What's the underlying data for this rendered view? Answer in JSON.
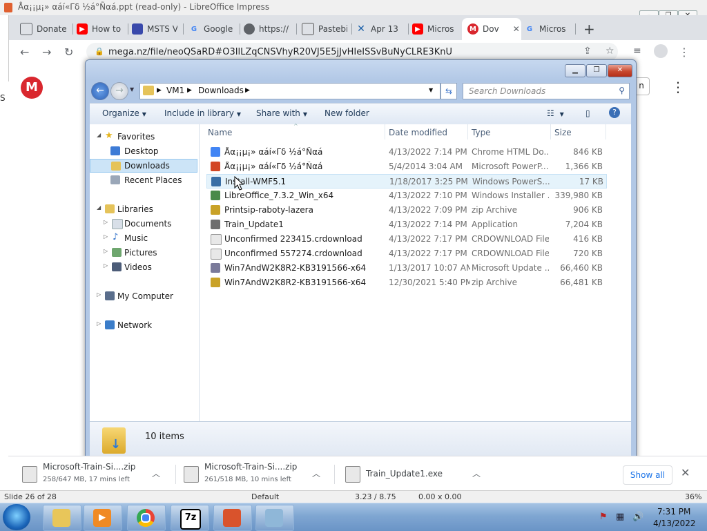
{
  "lo_window": {
    "title": "Åα¡¡µ¡» αáí«Γδ ½á°Ñαá.ppt (read-only) - LibreOffice Impress",
    "status_slide": "Slide 26 of 28",
    "status_layout": "Default",
    "status_pos": "3.23 / 8.75",
    "status_size": "0.00 x 0.00",
    "status_zoom": "36%"
  },
  "chrome": {
    "tabs": [
      {
        "label": "Donate",
        "icon": "page-icon",
        "color": "#5f6368"
      },
      {
        "label": "How to",
        "icon": "youtube-icon",
        "color": "#ff0000"
      },
      {
        "label": "MSTS V",
        "icon": "msts-icon",
        "color": "#3949ab"
      },
      {
        "label": "Google",
        "icon": "google-icon",
        "color": "#4285f4"
      },
      {
        "label": "https://",
        "icon": "globe-icon",
        "color": "#5f6368"
      },
      {
        "label": "Pastebi",
        "icon": "pastebin-icon",
        "color": "#555555"
      },
      {
        "label": "Apr 13",
        "icon": "cross-icon",
        "color": "#1a5fa8"
      },
      {
        "label": "Micros",
        "icon": "youtube-icon",
        "color": "#ff0000"
      },
      {
        "label": "Dov",
        "icon": "mega-icon",
        "color": "#d9272e"
      },
      {
        "label": "Micros",
        "icon": "google-icon",
        "color": "#4285f4"
      }
    ],
    "new_tab": "+",
    "url": "mega.nz/file/neoQSaRD#O3IlLZqCNSVhyR20VJ5E5jJvHIeISSvBuNyCLRE3KnU"
  },
  "mega": {
    "logo": "M",
    "side_text": "S",
    "menu": "⋮",
    "btn_partial": "n"
  },
  "explorer": {
    "breadcrumb": [
      "VM1",
      "Downloads"
    ],
    "search_placeholder": "Search Downloads",
    "toolbar": {
      "organize": "Organize",
      "include": "Include in library",
      "share": "Share with",
      "new_folder": "New folder"
    },
    "nav": {
      "favorites": "Favorites",
      "desktop": "Desktop",
      "downloads": "Downloads",
      "recent": "Recent Places",
      "libraries": "Libraries",
      "documents": "Documents",
      "music": "Music",
      "pictures": "Pictures",
      "videos": "Videos",
      "computer": "My Computer",
      "network": "Network"
    },
    "columns": {
      "name": "Name",
      "date": "Date modified",
      "type": "Type",
      "size": "Size"
    },
    "files": [
      {
        "name": "Åα¡¡µ¡» αáí«Γδ ½á°Ñαá",
        "date": "4/13/2022 7:14 PM",
        "type": "Chrome HTML Do...",
        "size": "846 KB",
        "icon": "chrome-html-icon",
        "color": "#4285f4"
      },
      {
        "name": "Åα¡¡µ¡» αáí«Γδ ½á°Ñαá",
        "date": "5/4/2014 3:04 AM",
        "type": "Microsoft PowerP...",
        "size": "1,366 KB",
        "icon": "powerpoint-icon",
        "color": "#d24726"
      },
      {
        "name": "Install-WMF5.1",
        "date": "1/18/2017 3:25 PM",
        "type": "Windows PowerS...",
        "size": "17 KB",
        "icon": "powershell-icon",
        "color": "#3a6ea5"
      },
      {
        "name": "LibreOffice_7.3.2_Win_x64",
        "date": "4/13/2022 7:10 PM",
        "type": "Windows Installer ...",
        "size": "339,980 KB",
        "icon": "msi-icon",
        "color": "#4a8a4a"
      },
      {
        "name": "Printsip-raboty-lazera",
        "date": "4/13/2022 7:09 PM",
        "type": "zip Archive",
        "size": "906 KB",
        "icon": "zip-icon",
        "color": "#c9a227"
      },
      {
        "name": "Train_Update1",
        "date": "4/13/2022 7:14 PM",
        "type": "Application",
        "size": "7,204 KB",
        "icon": "exe-icon",
        "color": "#6d6d6d"
      },
      {
        "name": "Unconfirmed 223415.crdownload",
        "date": "4/13/2022 7:17 PM",
        "type": "CRDOWNLOAD File",
        "size": "416 KB",
        "icon": "blank-file-icon",
        "color": "#e8e8e8"
      },
      {
        "name": "Unconfirmed 557274.crdownload",
        "date": "4/13/2022 7:17 PM",
        "type": "CRDOWNLOAD File",
        "size": "720 KB",
        "icon": "blank-file-icon",
        "color": "#e8e8e8"
      },
      {
        "name": "Win7AndW2K8R2-KB3191566-x64",
        "date": "1/13/2017 10:07 AM",
        "type": "Microsoft Update ...",
        "size": "66,460 KB",
        "icon": "msu-icon",
        "color": "#7a7a9a"
      },
      {
        "name": "Win7AndW2K8R2-KB3191566-x64",
        "date": "12/30/2021 5:40 PM",
        "type": "zip Archive",
        "size": "66,481 KB",
        "icon": "zip-icon",
        "color": "#c9a227"
      }
    ],
    "item_count": "10 items"
  },
  "downloads": [
    {
      "file": "Microsoft-Train-Si....zip",
      "status": "258/647 MB, 17 mins left"
    },
    {
      "file": "Microsoft-Train-Si....zip",
      "status": "261/518 MB, 10 mins left"
    },
    {
      "file": "Train_Update1.exe",
      "status": ""
    }
  ],
  "download_bar": {
    "show_all": "Show all"
  },
  "taskbar": {
    "apps": [
      {
        "name": "explorer",
        "glyph": "",
        "bg": "#e8c65a"
      },
      {
        "name": "media-player",
        "glyph": "▶",
        "bg": "#f08a24"
      },
      {
        "name": "chrome",
        "glyph": "",
        "bg": "#4285f4"
      },
      {
        "name": "7zip",
        "glyph": "7z",
        "bg": "#ffffff"
      },
      {
        "name": "libreoffice-impress",
        "glyph": "",
        "bg": "#d9532c"
      },
      {
        "name": "other-app",
        "glyph": "",
        "bg": "#8fb7d8"
      }
    ],
    "time": "7:31 PM",
    "date": "4/13/2022"
  }
}
